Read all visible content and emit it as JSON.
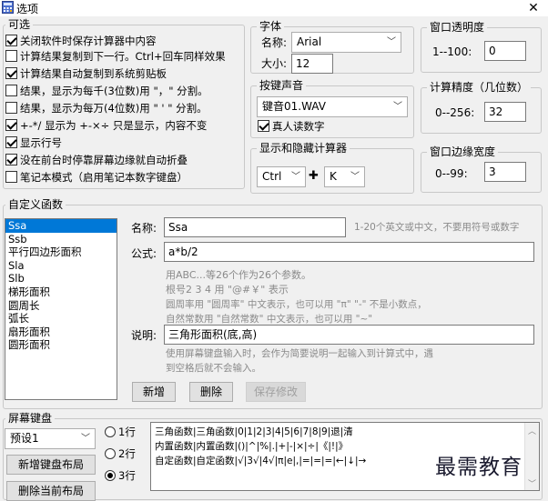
{
  "window": {
    "title": "选项",
    "close": "✕"
  },
  "optional": {
    "legend": "可选",
    "items": [
      {
        "label": "关闭软件时保存计算器中内容",
        "checked": true
      },
      {
        "label": "计算结果复制到下一行。Ctrl+回车同样效果",
        "checked": false
      },
      {
        "label": "计算结果自动复制到系统剪贴板",
        "checked": true
      },
      {
        "label": "结果，显示为每千(3位数)用 \"，\" 分割。",
        "checked": false
      },
      {
        "label": "结果，显示为每万(4位数)用 \" ' \" 分割。",
        "checked": false
      },
      {
        "label": "+-*/ 显示为 +-×÷ 只是显示，内容不变",
        "checked": true
      },
      {
        "label": "显示行号",
        "checked": true
      },
      {
        "label": "没在前台时停靠屏幕边缘就自动折叠",
        "checked": true
      },
      {
        "label": "笔记本模式（启用笔记本数字键盘）",
        "checked": false
      }
    ]
  },
  "font": {
    "legend": "字体",
    "name_label": "名称:",
    "name_value": "Arial",
    "size_label": "大小:",
    "size_value": "12"
  },
  "sound": {
    "legend": "按键声音",
    "value": "键音01.WAV",
    "voice_label": "真人读数字",
    "voice_checked": true
  },
  "hotkey": {
    "legend": "显示和隐藏计算器",
    "modifier": "Ctrl",
    "plus": "✚",
    "key": "K"
  },
  "opacity": {
    "legend": "窗口透明度",
    "range_label": "1--100:",
    "value": "0"
  },
  "precision": {
    "legend": "计算精度（几位数）",
    "range_label": "0--256:",
    "value": "32"
  },
  "edge": {
    "legend": "窗口边缘宽度",
    "range_label": "0--99:",
    "value": "3"
  },
  "custom": {
    "legend": "自定义函数",
    "list": [
      "Ssa",
      "Ssb",
      "平行四边形面积",
      "Sla",
      "Slb",
      "梯形面积",
      "圆周长",
      "弧长",
      "扇形面积",
      "圆形面积"
    ],
    "selected_index": 0,
    "name_label": "名称:",
    "name_value": "Ssa",
    "name_hint": "1-20个英文或中文，不要用符号或数字",
    "formula_label": "公式:",
    "formula_value": "a*b/2",
    "notes": [
      "用ABC...等26个作为26个参数。",
      "根号2 3 4 用 \"@#￥\" 表示",
      "圆周率用 \"圆周率\" 中文表示，也可以用 \"π\" \"-\" 不是小数点，",
      "自然常数用 \"自然常数\" 中文表示，也可以用 \"~\""
    ],
    "desc_label": "说明:",
    "desc_value": "三角形面积(底,高)",
    "desc_notes": [
      "使用屏幕键盘输入时，会作为简要说明一起输入到计算式中，遇",
      "到空格后就不会输入。"
    ],
    "buttons": {
      "add": "新增",
      "delete": "删除",
      "save": "保存修改"
    }
  },
  "keyboard": {
    "legend": "屏幕键盘",
    "preset": "预设1",
    "add_layout": "新增键盘布局",
    "delete_layout": "删除当前布局",
    "rows": [
      {
        "label": "1行",
        "selected": false
      },
      {
        "label": "2行",
        "selected": false
      },
      {
        "label": "3行",
        "selected": true
      }
    ],
    "lines": [
      "三角函数|三角函数|0|1|2|3|4|5|6|7|8|9|退|清",
      "内置函数|内置函数|()|^|%|.|+|-|×|÷|《|!|》",
      "自定函数|自定函数|√|3√|4√|π|e|,|=|=|=|←|↓|→"
    ]
  },
  "watermark": "最需教育"
}
